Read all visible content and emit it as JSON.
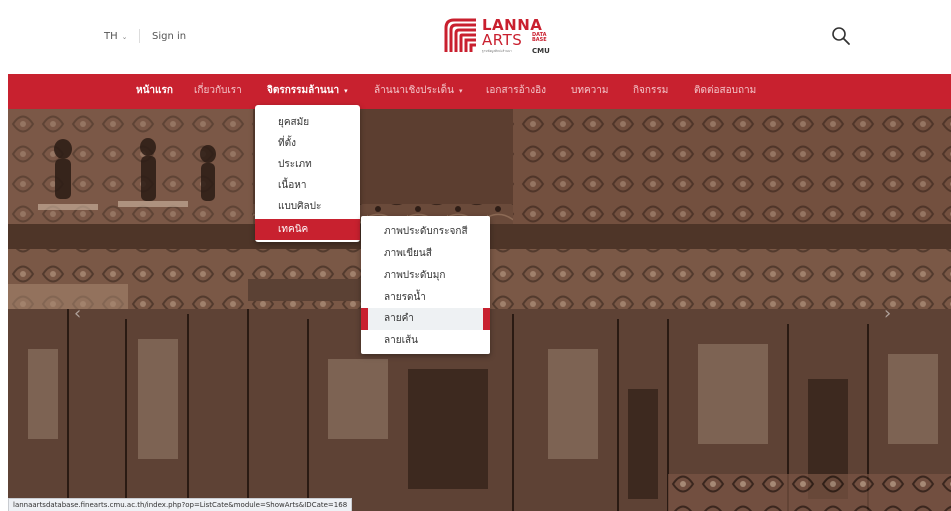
{
  "header": {
    "language": "TH",
    "sign_in": "Sign in",
    "logo": {
      "line1": "LANNA",
      "line2": "ARTS",
      "badge_line1": "DATA",
      "badge_line2": "BASE",
      "badge_line3": "CMU",
      "tagline": "ฐานข้อมูลศิลปะล้านนา"
    },
    "search_icon": "search-icon"
  },
  "nav": {
    "items": [
      {
        "label": "หน้าแรก",
        "state": "active"
      },
      {
        "label": "เกี่ยวกับเรา",
        "state": "normal"
      },
      {
        "label": "จิตรกรรมล้านนา",
        "state": "open",
        "has_caret": true
      },
      {
        "label": "ล้านนาเชิงประเด็น",
        "state": "normal",
        "has_caret": true
      },
      {
        "label": "เอกสารอ้างอิง",
        "state": "normal"
      },
      {
        "label": "บทความ",
        "state": "normal"
      },
      {
        "label": "กิจกรรม",
        "state": "normal"
      },
      {
        "label": "ติดต่อสอบถาม",
        "state": "normal"
      }
    ],
    "caret": "▾"
  },
  "dropdown_primary": {
    "items": [
      {
        "label": "ยุคสมัย"
      },
      {
        "label": "ที่ตั้ง"
      },
      {
        "label": "ประเภท"
      },
      {
        "label": "เนื้อหา"
      },
      {
        "label": "แบบศิลปะ"
      },
      {
        "label": "เทคนิค",
        "active": true
      }
    ]
  },
  "dropdown_secondary": {
    "items": [
      {
        "label": "ภาพประดับกระจกสี"
      },
      {
        "label": "ภาพเขียนสี"
      },
      {
        "label": "ภาพประดับมุก"
      },
      {
        "label": "ลายรดน้ำ"
      },
      {
        "label": "ลายคำ",
        "hover": true
      },
      {
        "label": "ลายเส้น"
      }
    ]
  },
  "carousel": {
    "prev_icon": "‹",
    "next_icon": "›"
  },
  "status_bar": {
    "url": "lannaartsdatabase.finearts.cmu.ac.th/index.php?op=ListCate&module=ShowArts&IDCate=168"
  },
  "colors": {
    "brand_red": "#c8212f",
    "nav_text": "#f3c7cb",
    "hover_bg": "#eef1f3"
  }
}
